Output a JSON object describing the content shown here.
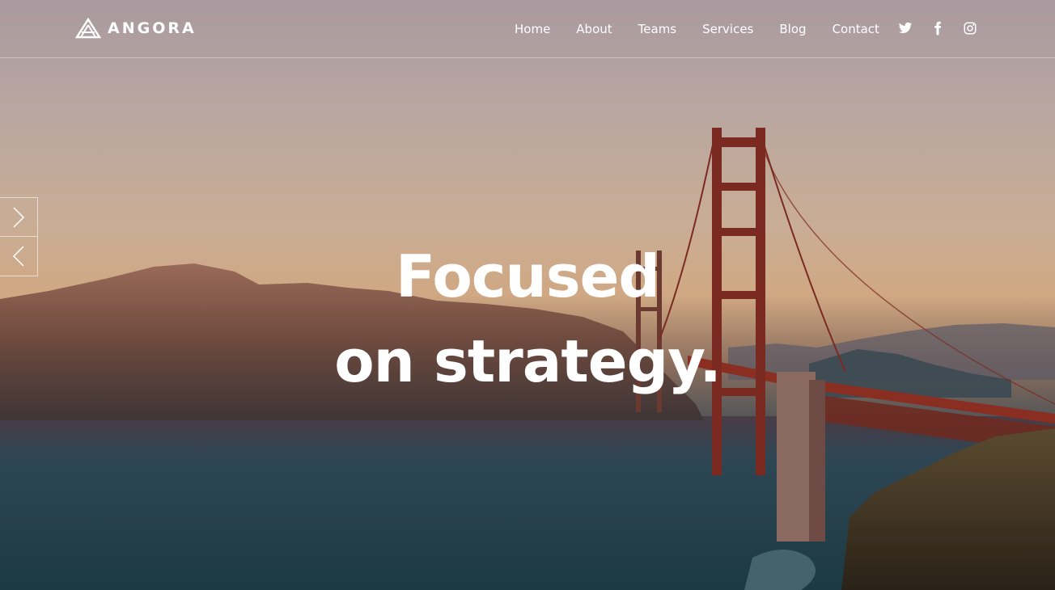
{
  "brand": {
    "name": "ANGORA",
    "logo_icon": "stacked-triangle-logo"
  },
  "nav": {
    "items": [
      {
        "label": "Home"
      },
      {
        "label": "About"
      },
      {
        "label": "Teams"
      },
      {
        "label": "Services"
      },
      {
        "label": "Blog"
      },
      {
        "label": "Contact"
      }
    ]
  },
  "social": [
    {
      "icon": "twitter-icon"
    },
    {
      "icon": "facebook-icon"
    },
    {
      "icon": "instagram-icon"
    }
  ],
  "slider": {
    "next_icon": "chevron-right-icon",
    "prev_icon": "chevron-left-icon"
  },
  "hero": {
    "line1": "Focused",
    "line2": "on strategy."
  },
  "colors": {
    "text": "#ffffff",
    "bridge": "#8a2e22",
    "water": "#1f3f4a",
    "sky": "#c9ad95"
  }
}
